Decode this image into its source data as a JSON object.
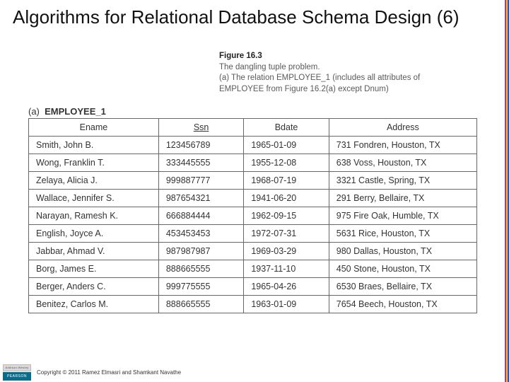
{
  "title": "Algorithms for Relational Database Schema Design (6)",
  "figure": {
    "label": "Figure 16.3",
    "line1": "The dangling tuple problem.",
    "line2": "(a) The relation EMPLOYEE_1 (includes all attributes of EMPLOYEE from Figure 16.2(a) except Dnum)"
  },
  "table": {
    "label_a": "(a)",
    "label_name": "EMPLOYEE_1",
    "headers": {
      "c1": "Ename",
      "c2": "Ssn",
      "c3": "Bdate",
      "c4": "Address"
    },
    "rows": [
      {
        "c1": "Smith, John B.",
        "c2": "123456789",
        "c3": "1965-01-09",
        "c4": "731 Fondren, Houston, TX"
      },
      {
        "c1": "Wong, Franklin T.",
        "c2": "333445555",
        "c3": "1955-12-08",
        "c4": "638 Voss, Houston, TX"
      },
      {
        "c1": "Zelaya, Alicia J.",
        "c2": "999887777",
        "c3": "1968-07-19",
        "c4": "3321 Castle, Spring, TX"
      },
      {
        "c1": "Wallace, Jennifer S.",
        "c2": "987654321",
        "c3": "1941-06-20",
        "c4": "291 Berry, Bellaire, TX"
      },
      {
        "c1": "Narayan, Ramesh K.",
        "c2": "666884444",
        "c3": "1962-09-15",
        "c4": "975 Fire Oak, Humble, TX"
      },
      {
        "c1": "English, Joyce A.",
        "c2": "453453453",
        "c3": "1972-07-31",
        "c4": "5631 Rice, Houston, TX"
      },
      {
        "c1": "Jabbar, Ahmad V.",
        "c2": "987987987",
        "c3": "1969-03-29",
        "c4": "980 Dallas, Houston, TX"
      },
      {
        "c1": "Borg, James E.",
        "c2": "888665555",
        "c3": "1937-11-10",
        "c4": "450 Stone, Houston, TX"
      },
      {
        "c1": "Berger, Anders C.",
        "c2": "999775555",
        "c3": "1965-04-26",
        "c4": "6530 Braes, Bellaire, TX"
      },
      {
        "c1": "Benitez, Carlos M.",
        "c2": "888665555",
        "c3": "1963-01-09",
        "c4": "7654 Beech, Houston, TX"
      }
    ]
  },
  "footer": {
    "badge_aw": "Addison-Wesley",
    "badge_p": "PEARSON",
    "copyright": "Copyright © 2011 Ramez Elmasri and Shamkant Navathe"
  }
}
